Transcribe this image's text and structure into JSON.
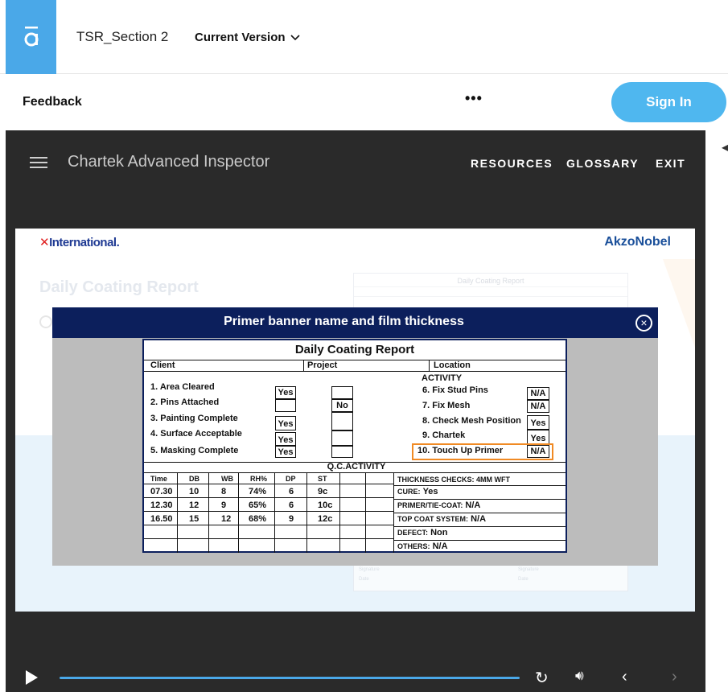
{
  "topbar": {
    "doc_title": "TSR_Section 2",
    "version_label": "Current Version"
  },
  "subbar": {
    "feedback_label": "Feedback",
    "more_label": "•••",
    "signin_label": "Sign In"
  },
  "player": {
    "course_title": "Chartek Advanced Inspector",
    "nav": [
      "RESOURCES",
      "GLOSSARY",
      "EXIT"
    ]
  },
  "slide": {
    "brand_left_mark": "✕",
    "brand_left": "International.",
    "brand_right": "AkzoNobel",
    "ghost_title": "Daily Coating Report",
    "ghost_report_title": "Daily Coating Report",
    "ghost_signature_label": "Signature",
    "ghost_date_label": "Date"
  },
  "modal": {
    "title": "Primer banner name and film thickness",
    "close_icon": "×"
  },
  "report": {
    "title": "Daily Coating Report",
    "client_label": "Client",
    "project_label": "Project",
    "location_label": "Location",
    "activity_label": "ACTIVITY",
    "left_items": [
      {
        "label": "1. Area Cleared",
        "yes": "Yes",
        "no": ""
      },
      {
        "label": "2. Pins Attached",
        "yes": "",
        "no": "No"
      },
      {
        "label": "3. Painting Complete",
        "yes": "Yes",
        "no": ""
      },
      {
        "label": "4. Surface Acceptable",
        "yes": "Yes",
        "no": ""
      },
      {
        "label": "5. Masking Complete",
        "yes": "Yes",
        "no": ""
      }
    ],
    "right_items": [
      {
        "label": "6. Fix Stud Pins",
        "value": "N/A"
      },
      {
        "label": "7. Fix Mesh",
        "value": "N/A"
      },
      {
        "label": "8. Check Mesh Position",
        "value": "Yes"
      },
      {
        "label": "9. Chartek",
        "value": "Yes"
      },
      {
        "label": "10. Touch Up Primer",
        "value": "N/A"
      }
    ],
    "qc_label": "Q.C.ACTIVITY",
    "qc_headers": [
      "Time",
      "DB",
      "WB",
      "RH%",
      "DP",
      "ST"
    ],
    "qc_rows": [
      [
        "07.30",
        "10",
        "8",
        "74%",
        "6",
        "9c"
      ],
      [
        "12.30",
        "12",
        "9",
        "65%",
        "6",
        "10c"
      ],
      [
        "16.50",
        "15",
        "12",
        "68%",
        "9",
        "12c"
      ]
    ],
    "checks": [
      {
        "label": "THICKNESS CHECKS: 4MM WFT",
        "value": ""
      },
      {
        "label": "CURE:",
        "value": "Yes"
      },
      {
        "label": "PRIMER/TIE-COAT:",
        "value": "N/A"
      },
      {
        "label": "TOP COAT SYSTEM:",
        "value": "N/A"
      },
      {
        "label": "DEFECT:",
        "value": "Non"
      },
      {
        "label": "OTHERS:",
        "value": "N/A"
      }
    ]
  },
  "colors": {
    "accent": "#4aa8e8",
    "modal_header": "#0c1f5c",
    "highlight": "#f08a24",
    "player_bg": "#2a2a2a"
  }
}
